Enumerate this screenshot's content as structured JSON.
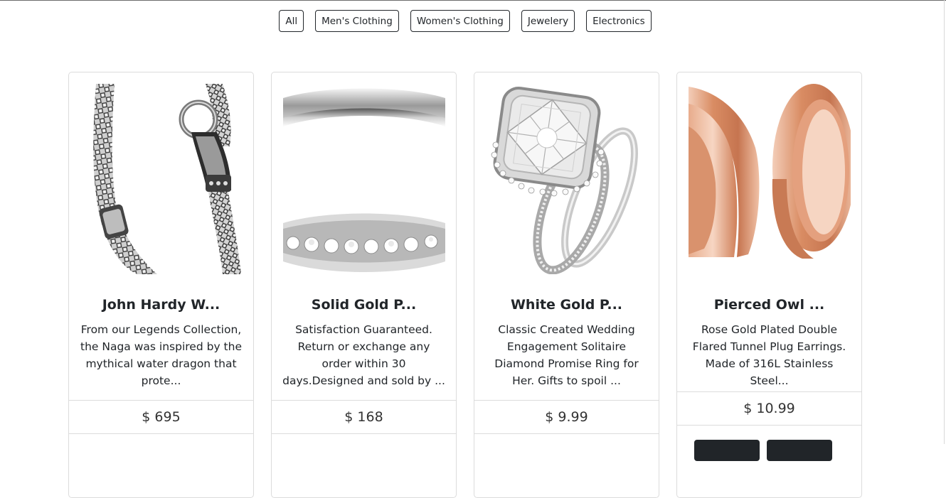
{
  "filters": [
    "All",
    "Men's Clothing",
    "Women's Clothing",
    "Jewelery",
    "Electronics"
  ],
  "products": [
    {
      "title": "John Hardy W...",
      "description": "From our Legends Collection, the Naga was inspired by the mythical water dragon that prote...",
      "price": "$ 695",
      "image_icon": "chain-bracelet-image"
    },
    {
      "title": "Solid Gold P...",
      "description": "Satisfaction Guaranteed. Return or exchange any order within 30 days.Designed and sold by ...",
      "price": "$ 168",
      "image_icon": "band-ring-image"
    },
    {
      "title": "White Gold P...",
      "description": "Classic Created Wedding Engagement Solitaire Diamond Promise Ring for Her. Gifts to spoil ...",
      "price": "$ 9.99",
      "image_icon": "diamond-ring-image"
    },
    {
      "title": "Pierced Owl ...",
      "description": "Rose Gold Plated Double Flared Tunnel Plug Earrings. Made of 316L Stainless Steel...",
      "price": "$ 10.99",
      "image_icon": "tunnel-plug-image"
    }
  ],
  "colors": {
    "button_border": "#212529",
    "card_border": "#dcdcdc",
    "action_bg": "#212529",
    "rose_gold": "#e0a07f"
  }
}
